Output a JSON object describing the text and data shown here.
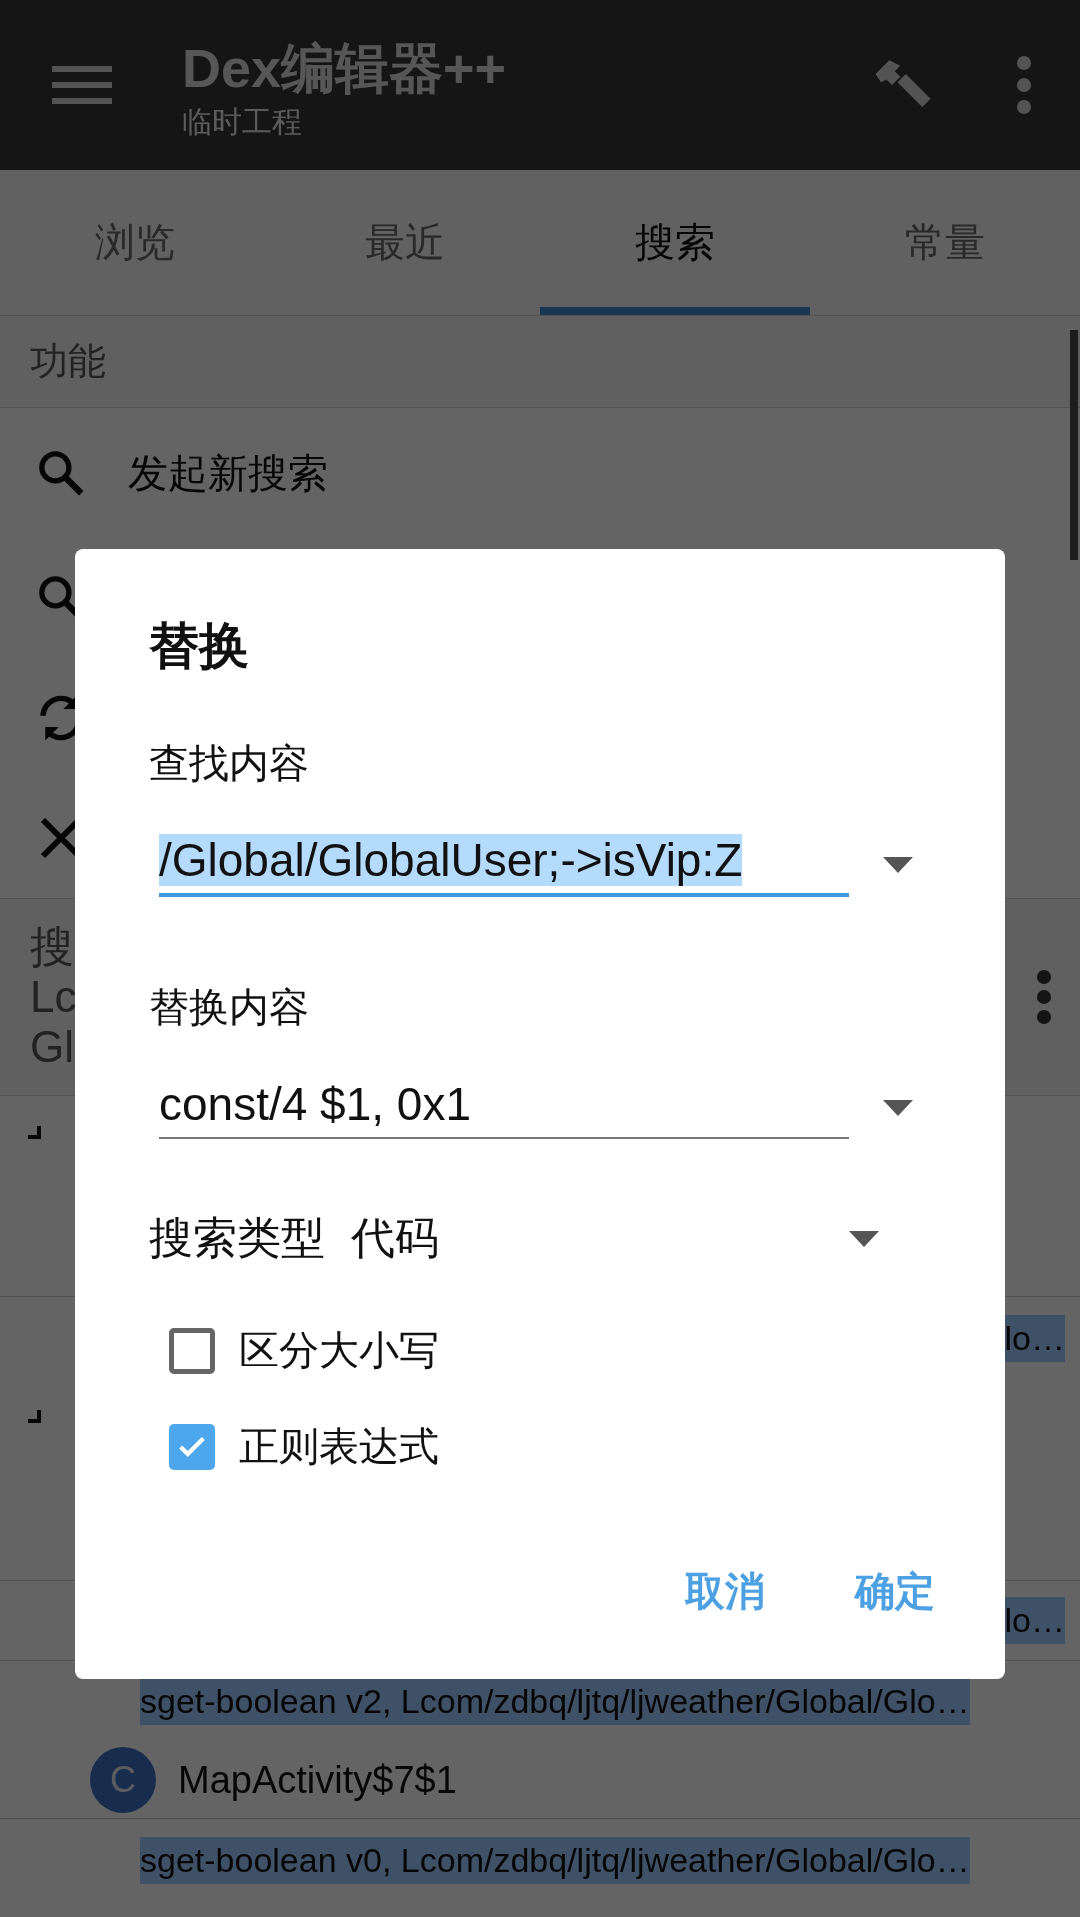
{
  "toolbar": {
    "title": "Dex编辑器++",
    "subtitle": "临时工程"
  },
  "tabs": [
    {
      "label": "浏览",
      "selected": false
    },
    {
      "label": "最近",
      "selected": false
    },
    {
      "label": "搜索",
      "selected": true
    },
    {
      "label": "常量",
      "selected": false
    }
  ],
  "section_header": "功能",
  "function_items": [
    {
      "kind": "search",
      "label": "发起新搜索"
    },
    {
      "kind": "search"
    },
    {
      "kind": "refresh"
    },
    {
      "kind": "close"
    }
  ],
  "search_header": {
    "lines": [
      "搜",
      "Lc",
      "Gl"
    ]
  },
  "results": [
    {
      "kind": "folded"
    },
    {
      "kind": "snippet_tail",
      "text": "lo…"
    },
    {
      "kind": "folded"
    },
    {
      "kind": "snippet_tail",
      "text": "lo…"
    },
    {
      "kind": "snippet",
      "text": "sget-boolean v2, Lcom/zdbq/ljtq/ljweather/Global/Glo…"
    },
    {
      "kind": "class",
      "badge": "C",
      "name": "MapActivity$7$1"
    },
    {
      "kind": "snippet",
      "text": "sget-boolean v0, Lcom/zdbq/ljtq/ljweather/Global/Glo…"
    }
  ],
  "dialog": {
    "title": "替换",
    "find": {
      "label": "查找内容",
      "value": "/Global/GlobalUser;->isVip:Z",
      "focused": true,
      "text_selected": true
    },
    "replace": {
      "label": "替换内容",
      "value": "const/4 $1, 0x1",
      "focused": false,
      "text_selected": false
    },
    "search_type": {
      "label": "搜索类型",
      "value": "代码"
    },
    "options": [
      {
        "label": "区分大小写",
        "checked": false
      },
      {
        "label": "正则表达式",
        "checked": true
      }
    ],
    "buttons": [
      "取消",
      "确定"
    ]
  }
}
